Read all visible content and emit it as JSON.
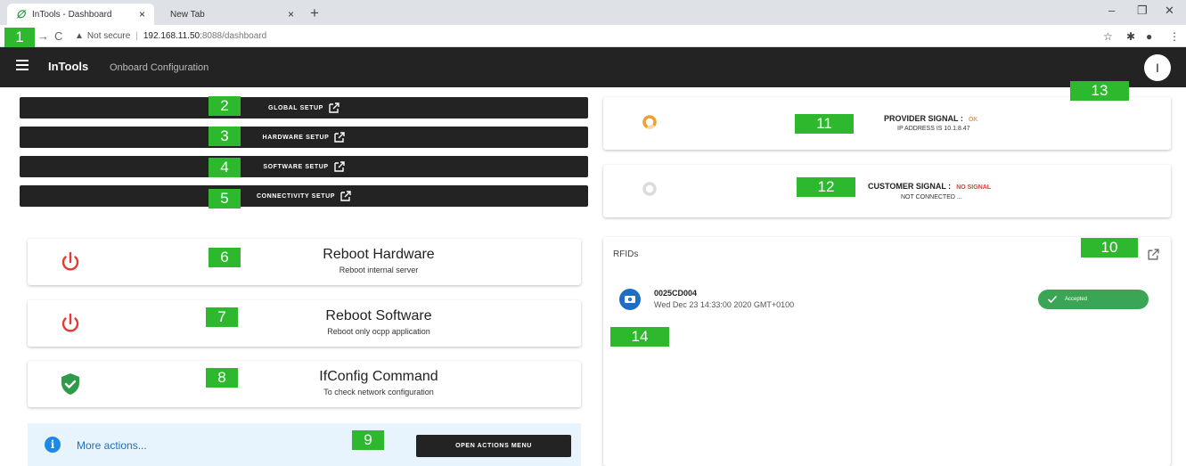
{
  "browser": {
    "tabs": [
      {
        "title": "InTools - Dashboard",
        "active": true
      },
      {
        "title": "New Tab",
        "active": false
      }
    ],
    "security_label": "Not secure",
    "url_host": "192.168.11.50",
    "url_path": ":8088/dashboard",
    "new_tab_symbol": "+",
    "close_symbol": "×"
  },
  "header": {
    "brand": "InTools",
    "subtitle": "Onboard Configuration",
    "avatar_initial": "I"
  },
  "setup_buttons": [
    {
      "label": "GLOBAL SETUP"
    },
    {
      "label": "HARDWARE SETUP"
    },
    {
      "label": "SOFTWARE SETUP"
    },
    {
      "label": "CONNECTIVITY SETUP"
    }
  ],
  "actions": [
    {
      "title": "Reboot Hardware",
      "subtitle": "Reboot internal server",
      "icon": "power-icon"
    },
    {
      "title": "Reboot Software",
      "subtitle": "Reboot only ocpp application",
      "icon": "power-icon"
    },
    {
      "title": "IfConfig Command",
      "subtitle": "To check network configuration",
      "icon": "shield-check-icon"
    }
  ],
  "more_actions": {
    "text": "More actions...",
    "button": "OPEN ACTIONS MENU"
  },
  "provider_signal": {
    "label": "PROVIDER SIGNAL :",
    "status": "OK",
    "detail": "IP ADDRESS IS 10.1.8.47"
  },
  "customer_signal": {
    "label": "CUSTOMER SIGNAL :",
    "status": "NO SIGNAL",
    "detail": "NOT CONNECTED ..."
  },
  "rfids": {
    "title": "RFIDs",
    "items": [
      {
        "id": "0025CD004",
        "date": "Wed Dec 23 14:33:00 2020 GMT+0100",
        "status": "Accepted"
      }
    ]
  },
  "markers": [
    "1",
    "2",
    "3",
    "4",
    "5",
    "6",
    "7",
    "8",
    "9",
    "10",
    "11",
    "12",
    "13",
    "14"
  ],
  "colors": {
    "accent_green": "#2eb82e",
    "power_red": "#e53935",
    "shield_green": "#2e9b4a",
    "signal_ok": "#f0a030",
    "signal_none": "#e53935",
    "info_blue": "#1e88e5"
  }
}
